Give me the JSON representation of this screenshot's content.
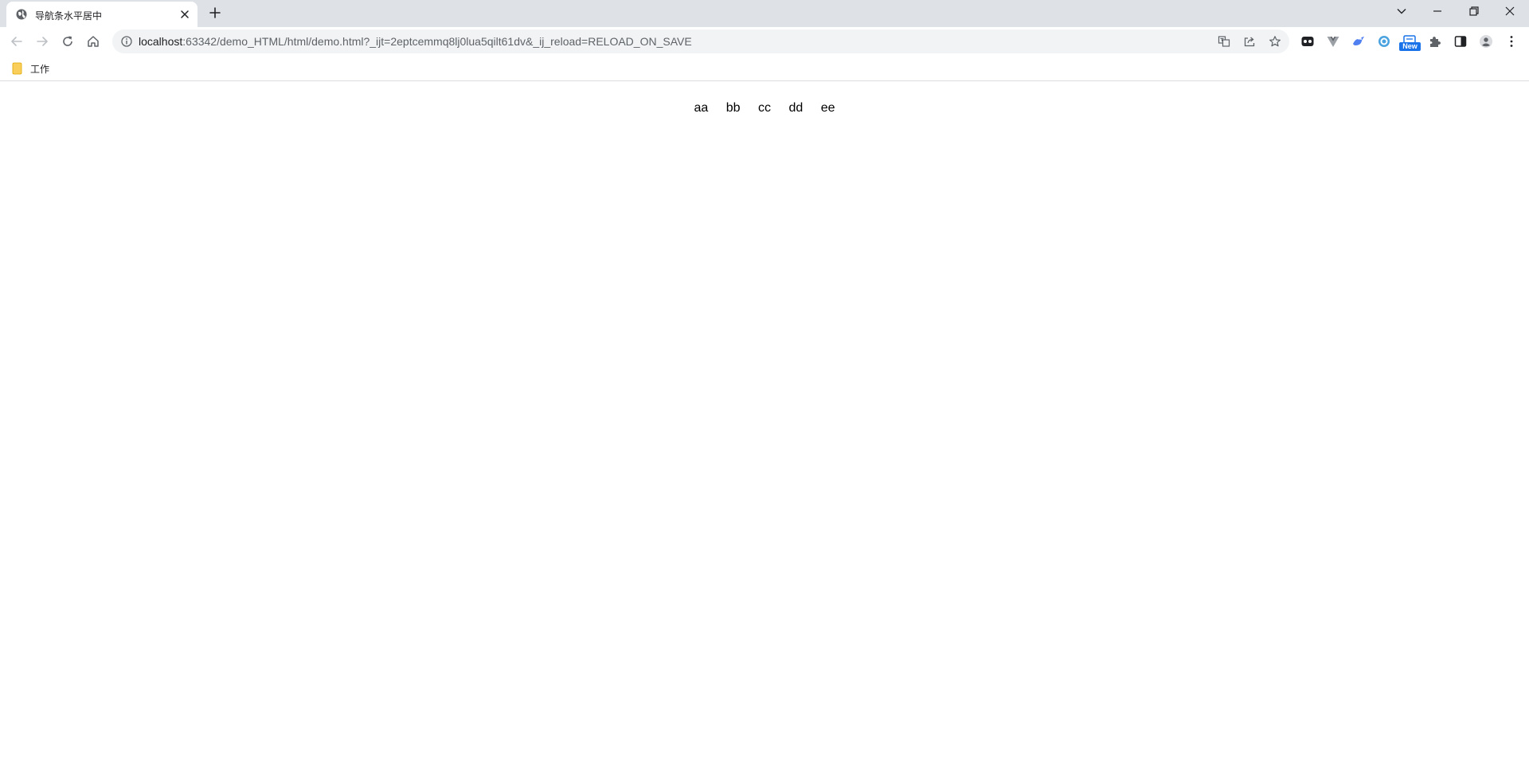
{
  "browser": {
    "tab": {
      "title": "导航条水平居中",
      "favicon": "globe-icon"
    },
    "url": {
      "host": "localhost",
      "rest": ":63342/demo_HTML/html/demo.html?_ijt=2eptcemmq8lj0lua5qilt61dv&_ij_reload=RELOAD_ON_SAVE"
    },
    "extensions": {
      "new_badge": "New"
    },
    "bookmarks": [
      {
        "label": "工作",
        "icon": "folder-icon"
      }
    ]
  },
  "page": {
    "nav_items": [
      "aa",
      "bb",
      "cc",
      "dd",
      "ee"
    ]
  },
  "colors": {
    "tabstrip": "#dee1e6",
    "omnibox": "#f1f3f4",
    "accent": "#1a73e8",
    "folder": "#f9ce5b"
  }
}
